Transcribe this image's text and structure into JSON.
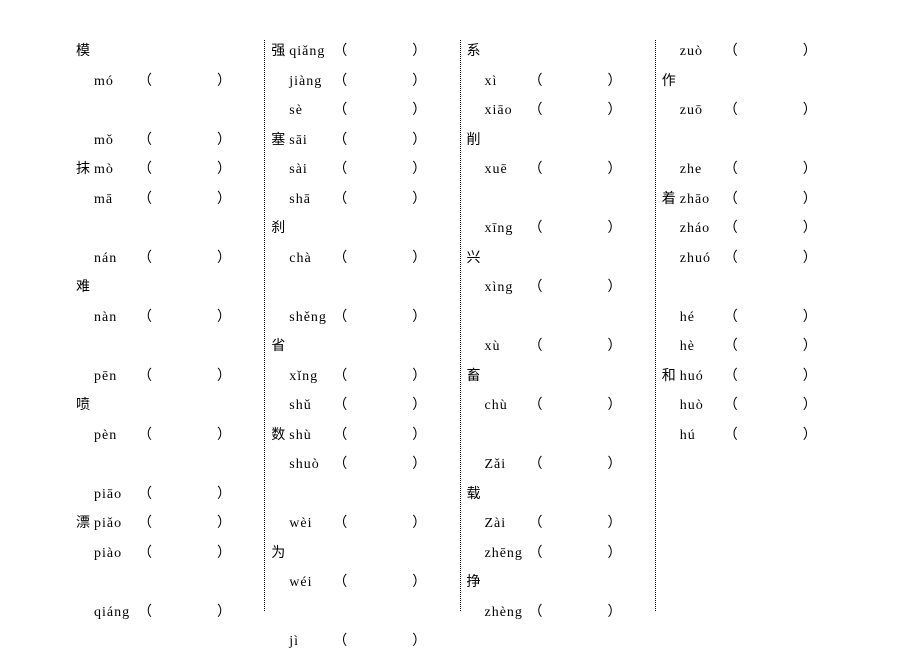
{
  "symbols": {
    "left_paren": "（",
    "right_paren": "）"
  },
  "columns": [
    {
      "lines": [
        {
          "hanzi": "模",
          "pinyin": ""
        },
        {
          "hanzi": "",
          "pinyin": "mó",
          "blank": true
        },
        {
          "hanzi": "",
          "pinyin": ""
        },
        {
          "hanzi": "",
          "pinyin": "mǒ",
          "blank": true
        },
        {
          "hanzi": "抹",
          "pinyin": "mò",
          "blank": true
        },
        {
          "hanzi": "",
          "pinyin": "mā",
          "blank": true
        },
        {
          "hanzi": "",
          "pinyin": ""
        },
        {
          "hanzi": "",
          "pinyin": "nán",
          "blank": true
        },
        {
          "hanzi": "难",
          "pinyin": ""
        },
        {
          "hanzi": "",
          "pinyin": "nàn",
          "blank": true
        },
        {
          "hanzi": "",
          "pinyin": ""
        },
        {
          "hanzi": "",
          "pinyin": "pēn",
          "blank": true
        },
        {
          "hanzi": "喷",
          "pinyin": ""
        },
        {
          "hanzi": "",
          "pinyin": "pèn",
          "blank": true
        },
        {
          "hanzi": "",
          "pinyin": ""
        },
        {
          "hanzi": "",
          "pinyin": "piāo",
          "blank": true
        },
        {
          "hanzi": "漂",
          "pinyin": "piǎo",
          "blank": true
        },
        {
          "hanzi": "",
          "pinyin": "piào",
          "blank": true
        },
        {
          "hanzi": "",
          "pinyin": ""
        },
        {
          "hanzi": "",
          "pinyin": "qiáng",
          "blank": true
        }
      ]
    },
    {
      "lines": [
        {
          "hanzi": "强",
          "pinyin": "qiǎng",
          "blank": true
        },
        {
          "hanzi": "",
          "pinyin": "jiàng",
          "blank": true
        },
        {
          "hanzi": "",
          "pinyin": "sè",
          "blank": true
        },
        {
          "hanzi": "塞",
          "pinyin": "sāi",
          "blank": true
        },
        {
          "hanzi": "",
          "pinyin": "sài",
          "blank": true
        },
        {
          "hanzi": "",
          "pinyin": "shā",
          "blank": true
        },
        {
          "hanzi": "刹",
          "pinyin": ""
        },
        {
          "hanzi": "",
          "pinyin": "chà",
          "blank": true
        },
        {
          "hanzi": "",
          "pinyin": ""
        },
        {
          "hanzi": "",
          "pinyin": "shěng",
          "blank": true
        },
        {
          "hanzi": "省",
          "pinyin": ""
        },
        {
          "hanzi": "",
          "pinyin": "xǐng",
          "blank": true
        },
        {
          "hanzi": "",
          "pinyin": "shǔ",
          "blank": true
        },
        {
          "hanzi": "数",
          "pinyin": "shù",
          "blank": true
        },
        {
          "hanzi": "",
          "pinyin": "shuò",
          "blank": true
        },
        {
          "hanzi": "",
          "pinyin": ""
        },
        {
          "hanzi": "",
          "pinyin": "wèi",
          "blank": true
        },
        {
          "hanzi": "为",
          "pinyin": ""
        },
        {
          "hanzi": "",
          "pinyin": "wéi",
          "blank": true
        },
        {
          "hanzi": "",
          "pinyin": ""
        },
        {
          "hanzi": "",
          "pinyin": "jì",
          "blank": true
        }
      ]
    },
    {
      "lines": [
        {
          "hanzi": "系",
          "pinyin": ""
        },
        {
          "hanzi": "",
          "pinyin": "xì",
          "blank": true
        },
        {
          "hanzi": "",
          "pinyin": "xiāo",
          "blank": true
        },
        {
          "hanzi": "削",
          "pinyin": ""
        },
        {
          "hanzi": "",
          "pinyin": "xuē",
          "blank": true
        },
        {
          "hanzi": "",
          "pinyin": ""
        },
        {
          "hanzi": "",
          "pinyin": "xīng",
          "blank": true
        },
        {
          "hanzi": "兴",
          "pinyin": ""
        },
        {
          "hanzi": "",
          "pinyin": "xìng",
          "blank": true
        },
        {
          "hanzi": "",
          "pinyin": ""
        },
        {
          "hanzi": "",
          "pinyin": "xù",
          "blank": true
        },
        {
          "hanzi": "畜",
          "pinyin": ""
        },
        {
          "hanzi": "",
          "pinyin": "chù",
          "blank": true
        },
        {
          "hanzi": "",
          "pinyin": ""
        },
        {
          "hanzi": "",
          "pinyin": "Zǎi",
          "blank": true
        },
        {
          "hanzi": "载",
          "pinyin": ""
        },
        {
          "hanzi": "",
          "pinyin": "Zài",
          "blank": true
        },
        {
          "hanzi": "",
          "pinyin": "zhēng",
          "blank": true
        },
        {
          "hanzi": "挣",
          "pinyin": ""
        },
        {
          "hanzi": "",
          "pinyin": "zhèng",
          "blank": true
        }
      ]
    },
    {
      "lines": [
        {
          "hanzi": "",
          "pinyin": "zuò",
          "blank": true
        },
        {
          "hanzi": "作",
          "pinyin": ""
        },
        {
          "hanzi": "",
          "pinyin": "zuō",
          "blank": true
        },
        {
          "hanzi": "",
          "pinyin": ""
        },
        {
          "hanzi": "",
          "pinyin": "zhe",
          "blank": true
        },
        {
          "hanzi": "着",
          "pinyin": "zhāo",
          "blank": true
        },
        {
          "hanzi": "",
          "pinyin": "zháo",
          "blank": true
        },
        {
          "hanzi": "",
          "pinyin": "zhuó",
          "blank": true
        },
        {
          "hanzi": "",
          "pinyin": ""
        },
        {
          "hanzi": "",
          "pinyin": "hé",
          "blank": true
        },
        {
          "hanzi": "",
          "pinyin": "hè",
          "blank": true
        },
        {
          "hanzi": "和",
          "pinyin": "huó",
          "blank": true
        },
        {
          "hanzi": "",
          "pinyin": "huò",
          "blank": true
        },
        {
          "hanzi": "",
          "pinyin": "hú",
          "blank": true
        }
      ]
    }
  ]
}
